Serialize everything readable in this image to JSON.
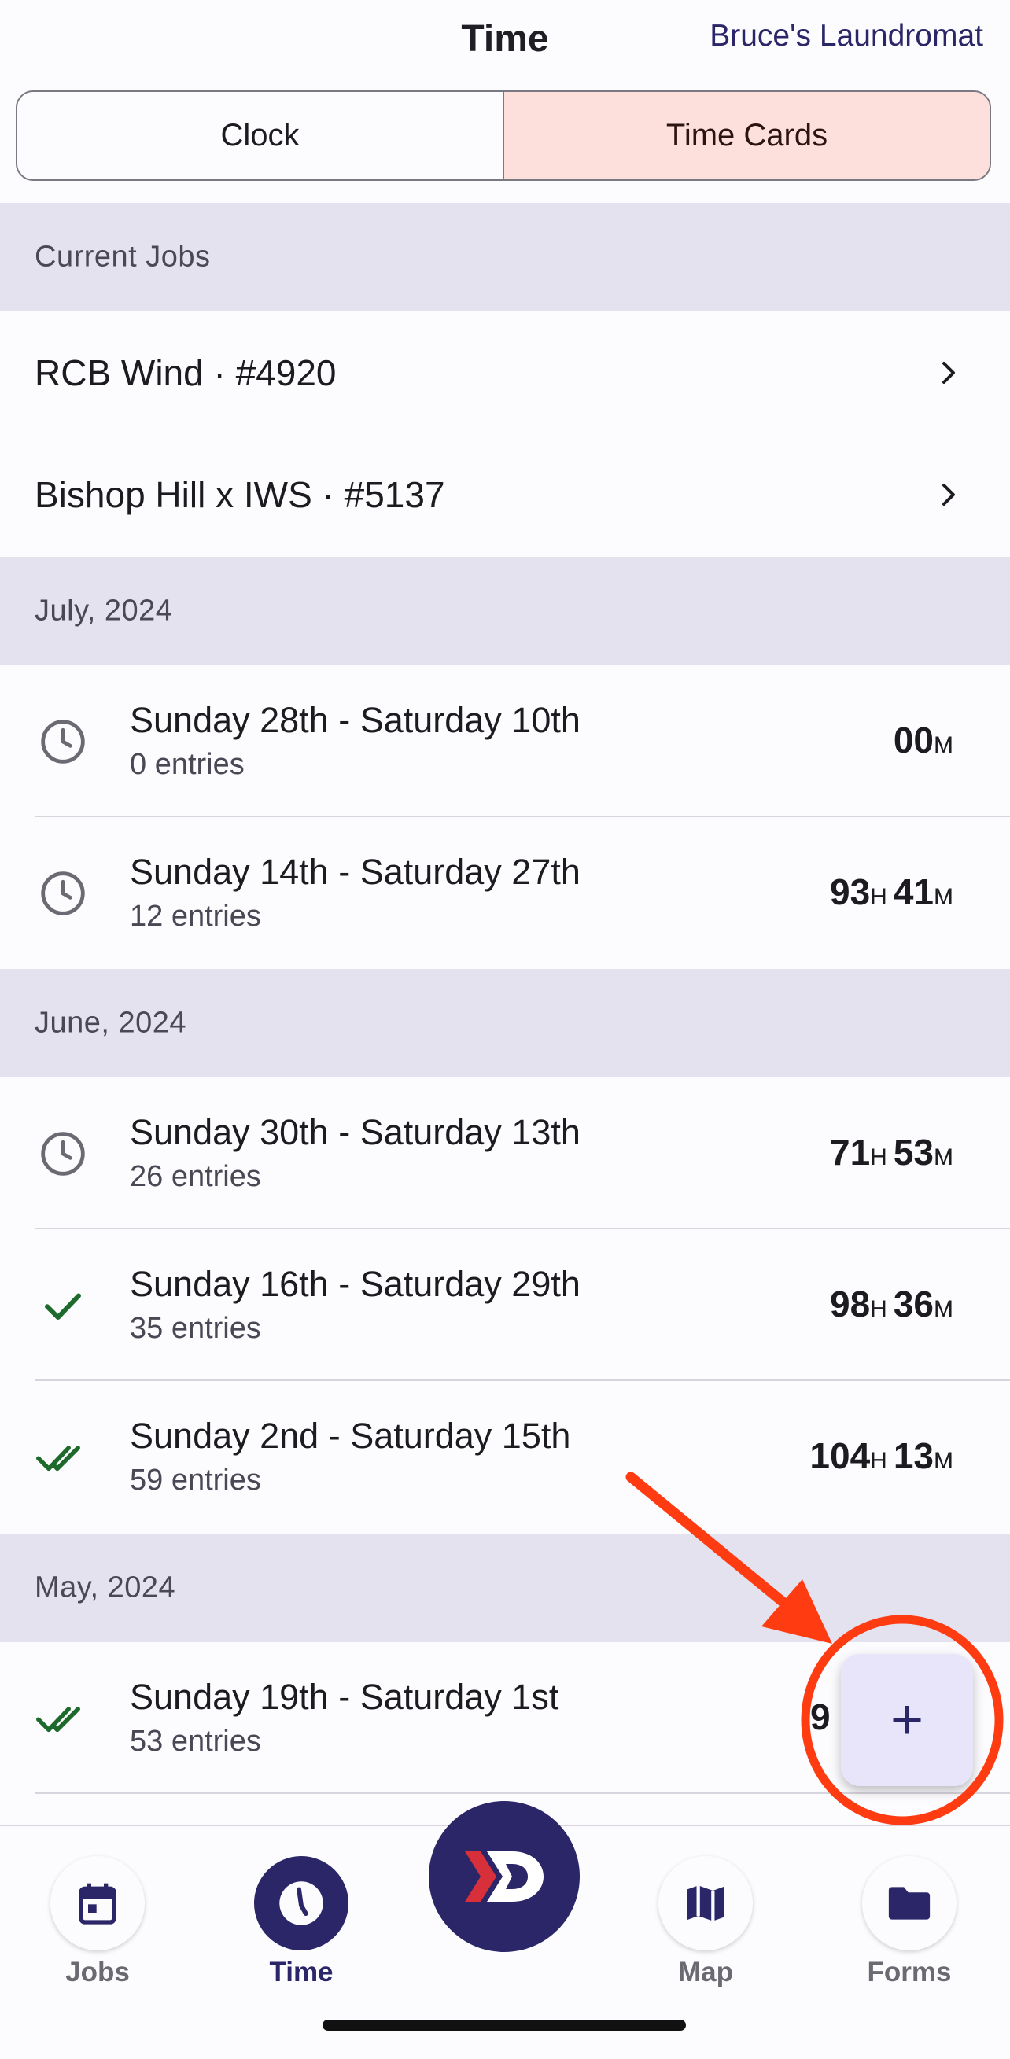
{
  "header": {
    "title": "Time",
    "account": "Bruce's Laundromat"
  },
  "segmented": {
    "clock": "Clock",
    "time_cards": "Time Cards",
    "selected": "Time Cards"
  },
  "current_jobs": {
    "heading": "Current Jobs",
    "items": [
      {
        "label": "RCB Wind · #4920"
      },
      {
        "label": "Bishop Hill x IWS · #5137"
      }
    ]
  },
  "months": [
    {
      "heading": "July, 2024",
      "cards": [
        {
          "range": "Sunday 28th - Saturday 10th",
          "entries": "0 entries",
          "status": "clock-icon",
          "hours": "",
          "minutes": "00"
        },
        {
          "range": "Sunday 14th - Saturday 27th",
          "entries": "12 entries",
          "status": "clock-icon",
          "hours": "93",
          "minutes": "41"
        }
      ]
    },
    {
      "heading": "June, 2024",
      "cards": [
        {
          "range": "Sunday 30th - Saturday 13th",
          "entries": "26 entries",
          "status": "clock-icon",
          "hours": "71",
          "minutes": "53"
        },
        {
          "range": "Sunday 16th - Saturday 29th",
          "entries": "35 entries",
          "status": "check-icon",
          "hours": "98",
          "minutes": "36"
        },
        {
          "range": "Sunday 2nd - Saturday 15th",
          "entries": "59 entries",
          "status": "double-check-icon",
          "hours": "104",
          "minutes": "13"
        }
      ]
    },
    {
      "heading": "May, 2024",
      "cards": [
        {
          "range": "Sunday 19th - Saturday 1st",
          "entries": "53 entries",
          "status": "double-check-icon",
          "hours_partial": "9"
        }
      ]
    }
  ],
  "units": {
    "h": "H",
    "m": "M"
  },
  "fab": {
    "label": "+"
  },
  "nav": {
    "jobs": "Jobs",
    "time": "Time",
    "map": "Map",
    "forms": "Forms",
    "active": "Time"
  },
  "colors": {
    "brand": "#2a2668",
    "accent_selected": "#fde0db",
    "section_bg": "#e5e2ef",
    "approved_green": "#1e6a2c",
    "annotation_orange": "#ff3b12"
  }
}
